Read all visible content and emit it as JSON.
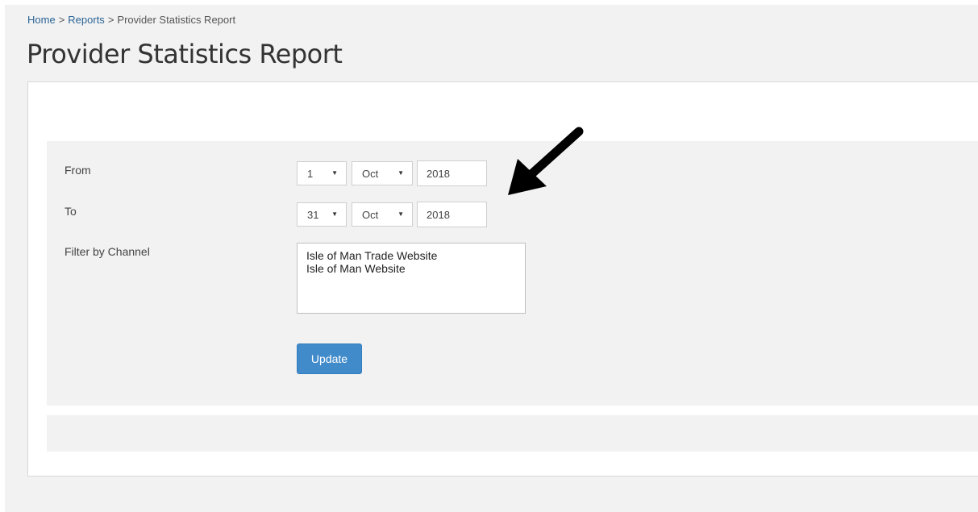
{
  "breadcrumb": {
    "home": "Home",
    "reports": "Reports",
    "current": "Provider Statistics Report",
    "separator": ">"
  },
  "page_title": "Provider Statistics Report",
  "form": {
    "from": {
      "label": "From",
      "day": "1",
      "month": "Oct",
      "year": "2018"
    },
    "to": {
      "label": "To",
      "day": "31",
      "month": "Oct",
      "year": "2018"
    },
    "channel": {
      "label": "Filter by Channel",
      "options": [
        "Isle of Man Trade Website",
        "Isle of Man Website"
      ]
    },
    "update_label": "Update"
  },
  "annotation": {
    "icon": "arrow-down-left-icon",
    "color": "#000000"
  },
  "colors": {
    "accent": "#428bca",
    "link": "#2a6496",
    "background": "#f2f2f2"
  }
}
